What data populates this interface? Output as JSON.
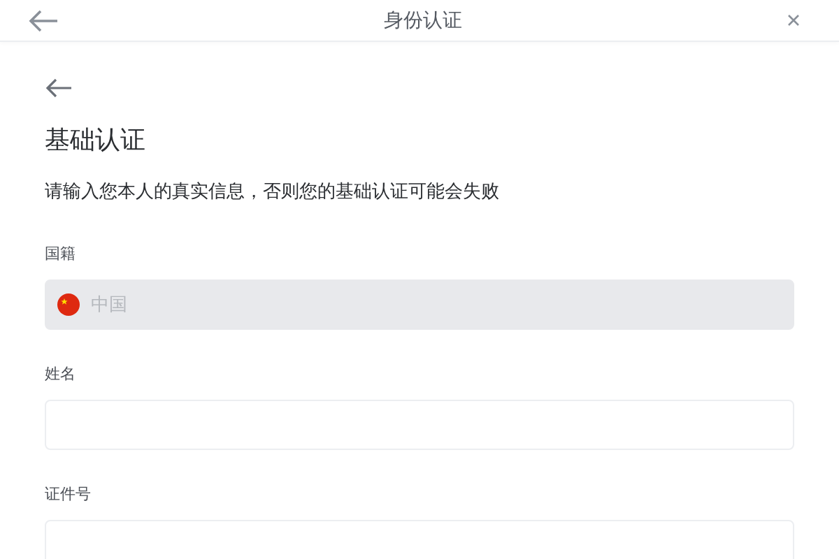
{
  "window": {
    "title": "身份认证"
  },
  "page": {
    "title": "基础认证",
    "description": "请输入您本人的真实信息，否则您的基础认证可能会失败"
  },
  "fields": [
    {
      "label": "国籍",
      "value": "中国",
      "disabled": true,
      "kind": "country"
    },
    {
      "label": "姓名",
      "disabled": false,
      "kind": "text"
    },
    {
      "label": "证件号",
      "disabled": false,
      "kind": "text"
    }
  ]
}
